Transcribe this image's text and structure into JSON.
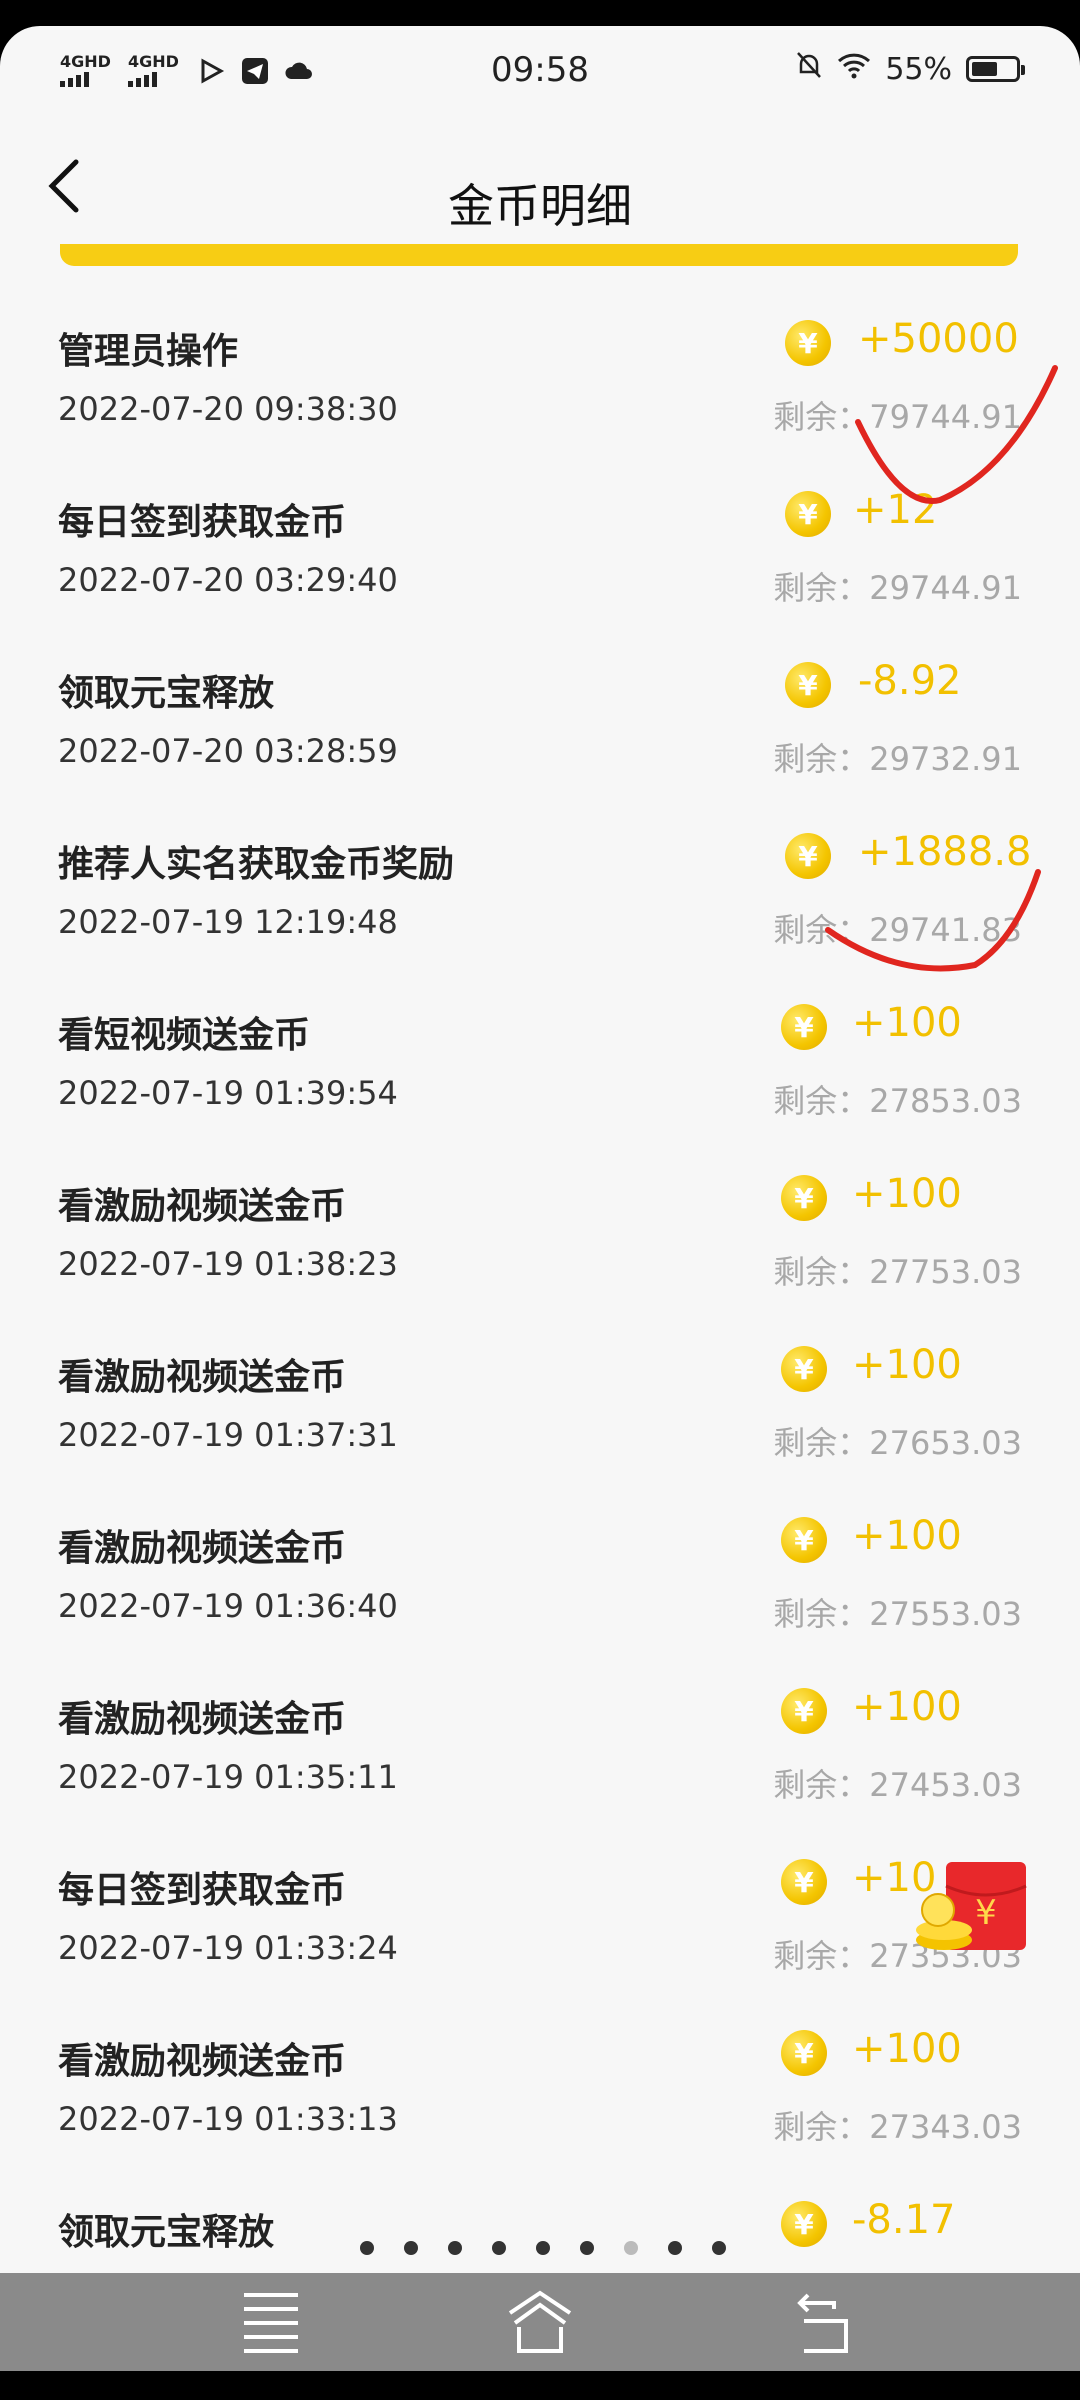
{
  "status_bar": {
    "signal1": "4GHD",
    "signal2": "4GHD",
    "time": "09:58",
    "battery": "55%",
    "battery_level": 0.55
  },
  "header": {
    "title": "金币明细"
  },
  "colors": {
    "accent": "#f7cd14",
    "amount": "#f2c000",
    "nav": "#8a8a8a"
  },
  "records": [
    {
      "name": "管理员操作",
      "time": "2022-07-20 09:38:30",
      "amount": "+50000",
      "remain": "剩余：79744.91"
    },
    {
      "name": "每日签到获取金币",
      "time": "2022-07-20 03:29:40",
      "amount": "+12",
      "remain": "剩余：29744.91"
    },
    {
      "name": "领取元宝释放",
      "time": "2022-07-20 03:28:59",
      "amount": "-8.92",
      "remain": "剩余：29732.91"
    },
    {
      "name": "推荐人实名获取金币奖励",
      "time": "2022-07-19 12:19:48",
      "amount": "+1888.8",
      "remain": "剩余：29741.83"
    },
    {
      "name": "看短视频送金币",
      "time": "2022-07-19 01:39:54",
      "amount": "+100",
      "remain": "剩余：27853.03"
    },
    {
      "name": "看激励视频送金币",
      "time": "2022-07-19 01:38:23",
      "amount": "+100",
      "remain": "剩余：27753.03"
    },
    {
      "name": "看激励视频送金币",
      "time": "2022-07-19 01:37:31",
      "amount": "+100",
      "remain": "剩余：27653.03"
    },
    {
      "name": "看激励视频送金币",
      "time": "2022-07-19 01:36:40",
      "amount": "+100",
      "remain": "剩余：27553.03"
    },
    {
      "name": "看激励视频送金币",
      "time": "2022-07-19 01:35:11",
      "amount": "+100",
      "remain": "剩余：27453.03"
    },
    {
      "name": "每日签到获取金币",
      "time": "2022-07-19 01:33:24",
      "amount": "+10",
      "remain": "剩余：27353.03"
    },
    {
      "name": "看激励视频送金币",
      "time": "2022-07-19 01:33:13",
      "amount": "+100",
      "remain": "剩余：27343.03"
    },
    {
      "name": "领取元宝释放",
      "time": "",
      "amount": "-8.17",
      "remain": ""
    }
  ],
  "coin_symbol": "¥",
  "page_dots": {
    "count": 9,
    "active_index": 6
  },
  "nav": {
    "menu_icon": "menu-icon",
    "home_icon": "home-icon",
    "back_icon": "back-icon"
  }
}
